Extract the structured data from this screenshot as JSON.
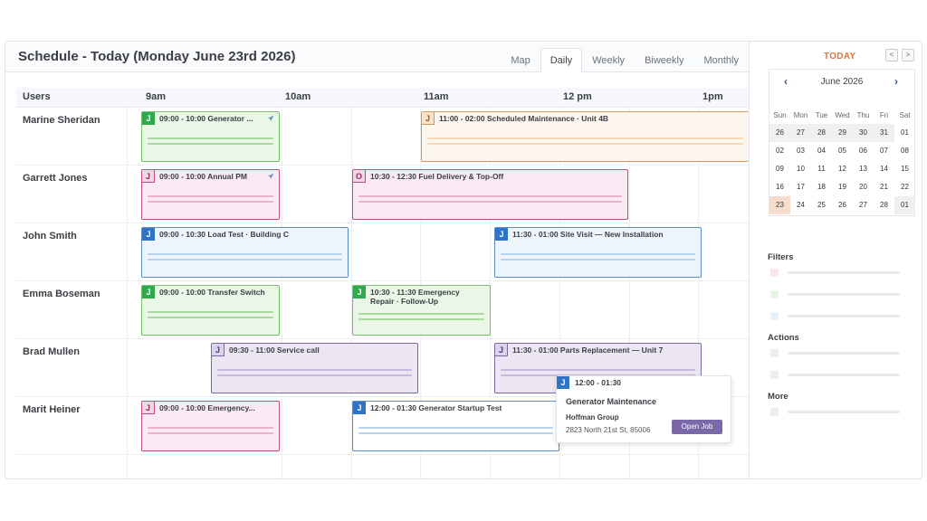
{
  "header": {
    "title": "Schedule - Today (Monday June 23rd 2026)",
    "views": [
      "Map",
      "Daily",
      "Weekly",
      "Biweekly",
      "Monthly"
    ],
    "active_view": "Daily"
  },
  "grid": {
    "users_label": "Users",
    "hours": [
      "9am",
      "10am",
      "11am",
      "12 pm",
      "1pm"
    ]
  },
  "rows": [
    {
      "user": "Marine Sheridan",
      "events": [
        {
          "badge": "J",
          "label": "09:00 - 10:00 Generator ...",
          "color": "green",
          "nav": true
        },
        {
          "badge": "J",
          "label": "11:00 - 02:00 Scheduled Maintenance · Unit 4B",
          "color": "orange"
        }
      ]
    },
    {
      "user": "Garrett Jones",
      "events": [
        {
          "badge": "J",
          "label": "09:00 - 10:00 Annual PM",
          "color": "pink",
          "nav": true
        },
        {
          "badge": "O",
          "label": "10:30 - 12:30 Fuel Delivery & Top-Off",
          "color": "pink"
        }
      ]
    },
    {
      "user": "John Smith",
      "events": [
        {
          "badge": "J",
          "label": "09:00 - 10:30 Load Test · Building C",
          "color": "blue"
        },
        {
          "badge": "J",
          "label": "11:30 - 01:00 Site Visit — New Installation",
          "color": "blue"
        }
      ]
    },
    {
      "user": "Emma Boseman",
      "events": [
        {
          "badge": "J",
          "label": "09:00 - 10:00 Transfer Switch",
          "color": "green"
        },
        {
          "badge": "J",
          "label": "10:30 - 11:30 Emergency Repair · Follow-Up",
          "color": "green"
        }
      ]
    },
    {
      "user": "Brad Mullen",
      "events": [
        {
          "badge": "J",
          "label": "09:30 - 11:00 Service call",
          "color": "purple"
        },
        {
          "badge": "J",
          "label": "11:30 - 01:00 Parts Replacement — Unit 7",
          "color": "purple"
        }
      ]
    },
    {
      "user": "Marit Heiner",
      "events": [
        {
          "badge": "J",
          "label": "09:00 - 10:00 Emergency...",
          "color": "pink"
        },
        {
          "badge": "J",
          "label": "12:00 - 01:30 Generator Startup Test",
          "color": "blue"
        }
      ]
    }
  ],
  "popup": {
    "badge": "J",
    "time": "12:00 - 01:30",
    "title": "Generator Maintenance",
    "customer": "Hoffman Group",
    "address": "2823 North 21st St, 85006",
    "button": "Open Job"
  },
  "sidebar": {
    "today_label": "TODAY",
    "prev": "<",
    "next": ">",
    "calendar": {
      "month": "June 2026",
      "prev": "‹",
      "next": "›",
      "dow": [
        "Sun",
        "Mon",
        "Tue",
        "Wed",
        "Thu",
        "Fri",
        "Sat"
      ],
      "weeks": [
        [
          "26",
          "27",
          "28",
          "29",
          "30",
          "31",
          "01"
        ],
        [
          "02",
          "03",
          "04",
          "05",
          "06",
          "07",
          "08"
        ],
        [
          "09",
          "10",
          "11",
          "12",
          "13",
          "14",
          "15"
        ],
        [
          "16",
          "17",
          "18",
          "19",
          "20",
          "21",
          "22"
        ],
        [
          "23",
          "24",
          "25",
          "26",
          "27",
          "28",
          "01"
        ]
      ],
      "selected": "23"
    },
    "filters_label": "Filters",
    "actions_label": "Actions",
    "more_label": "More"
  }
}
